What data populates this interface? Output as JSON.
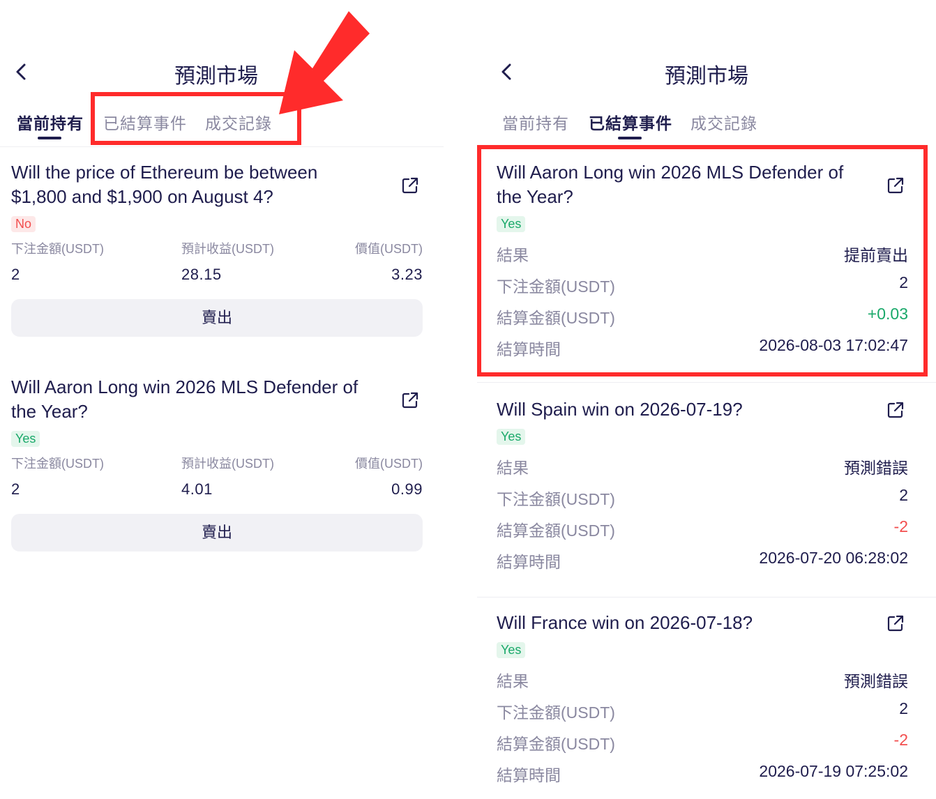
{
  "left": {
    "title": "預測市場",
    "tabs": [
      "當前持有",
      "已結算事件",
      "成交記錄"
    ],
    "labels": {
      "bet": "下注金額(USDT)",
      "expected": "預計收益(USDT)",
      "value": "價值(USDT)"
    },
    "sell_label": "賣出",
    "holdings": [
      {
        "question": "Will the price of Ethereum be between $1,800 and $1,900 on August 4?",
        "badge": "No",
        "bet": "2",
        "expected": "28.15",
        "value": "3.23"
      },
      {
        "question": "Will Aaron Long win 2026 MLS Defender of the Year?",
        "badge": "Yes",
        "bet": "2",
        "expected": "4.01",
        "value": "0.99"
      }
    ]
  },
  "right": {
    "title": "預測市場",
    "tabs": [
      "當前持有",
      "已結算事件",
      "成交記錄"
    ],
    "labels": {
      "result": "結果",
      "bet": "下注金額(USDT)",
      "settle": "結算金額(USDT)",
      "time": "結算時間"
    },
    "settled": [
      {
        "question": "Will Aaron Long win 2026 MLS Defender of the Year?",
        "badge": "Yes",
        "result": "提前賣出",
        "bet": "2",
        "settle": "+0.03",
        "time": "2026-08-03 17:02:47"
      },
      {
        "question": "Will Spain win on 2026-07-19?",
        "badge": "Yes",
        "result": "預測錯誤",
        "bet": "2",
        "settle": "-2",
        "time": "2026-07-20 06:28:02"
      },
      {
        "question": "Will France win on 2026-07-18?",
        "badge": "Yes",
        "result": "預測錯誤",
        "bet": "2",
        "settle": "-2",
        "time": "2026-07-19 07:25:02"
      }
    ]
  },
  "colors": {
    "primary": "#1f1d4d",
    "muted": "#8a88a0",
    "positive": "#1aa96a",
    "negative": "#f24e4e",
    "highlight": "#ff2b2b"
  }
}
